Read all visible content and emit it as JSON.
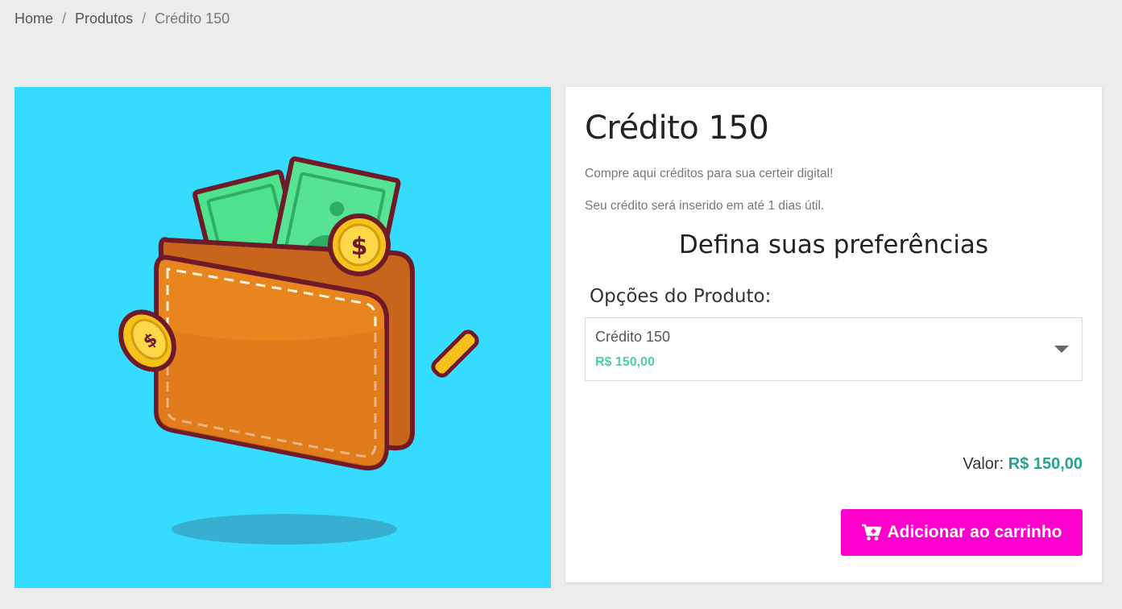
{
  "breadcrumb": {
    "home": "Home",
    "products": "Produtos",
    "current": "Crédito 150",
    "separator": "/"
  },
  "product": {
    "image_icon": "wallet-with-money-illustration",
    "image_background": "#35dcff",
    "title": "Crédito 150",
    "description_1": "Compre aqui créditos para sua certeir digital!",
    "description_2": "Seu crédito será inserido em até 1 dias útil."
  },
  "preferences": {
    "heading": "Defina suas preferências",
    "options_label": "Opções do Produto:",
    "selected_option": {
      "name": "Crédito 150",
      "price": "R$ 150,00"
    }
  },
  "total": {
    "label": "Valor:",
    "amount": "R$ 150,00"
  },
  "cart_button": {
    "label": "Adicionar ao carrinho",
    "icon": "cart-plus-icon",
    "color": "#ff00cc"
  },
  "colors": {
    "price_green": "#4ccfa3",
    "total_green": "#22a58f",
    "page_background": "#ececec"
  }
}
